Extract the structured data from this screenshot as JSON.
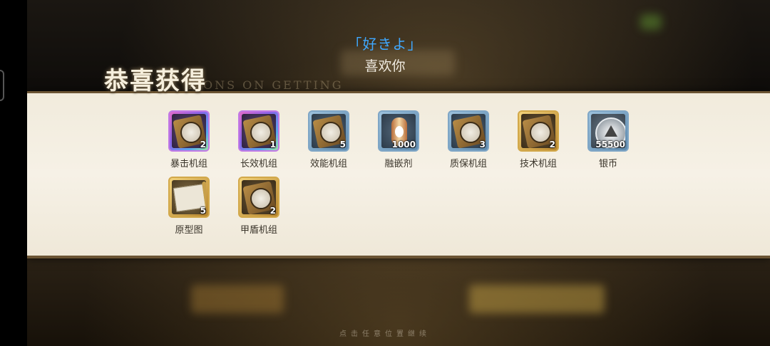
{
  "subtitle": {
    "japanese": "「好きよ」",
    "chinese": "喜欢你"
  },
  "reward_panel": {
    "title": "恭喜获得",
    "title_en": "TIONS ON GETTING",
    "items": [
      {
        "name": "暴击机组",
        "count": "2",
        "rarity": "purple",
        "icon": "crit-module-icon"
      },
      {
        "name": "长效机组",
        "count": "1",
        "rarity": "purple",
        "icon": "duration-module-icon"
      },
      {
        "name": "效能机组",
        "count": "5",
        "rarity": "blue",
        "icon": "efficiency-module-icon"
      },
      {
        "name": "融嵌剂",
        "count": "1000",
        "rarity": "blue",
        "icon": "fusion-agent-icon"
      },
      {
        "name": "质保机组",
        "count": "3",
        "rarity": "blue",
        "icon": "warranty-module-icon"
      },
      {
        "name": "技术机组",
        "count": "2",
        "rarity": "gold",
        "icon": "tech-module-icon"
      },
      {
        "name": "银币",
        "count": "55500",
        "rarity": "blue",
        "icon": "silver-coin-icon"
      },
      {
        "name": "原型图",
        "count": "5",
        "rarity": "gold",
        "icon": "blueprint-icon"
      },
      {
        "name": "甲盾机组",
        "count": "2",
        "rarity": "gold",
        "icon": "shield-module-icon"
      }
    ]
  },
  "footer": {
    "hint": "点击任意位置继续"
  },
  "colors": {
    "accent_blue": "#3fa8ff",
    "panel_bg": "#f3eee2",
    "panel_border": "#6b5433"
  }
}
